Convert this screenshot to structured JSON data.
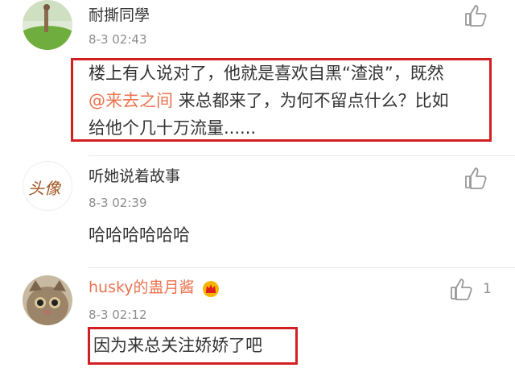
{
  "comments": [
    {
      "username": "耐撕同學",
      "time": "8-3 02:43",
      "text_part1": "楼上有人说对了，他就是喜欢自黑“渣浪”，既然",
      "mention": "@来去之间",
      "text_part2": " 来总都来了，为何不留点什么？比如",
      "text_part3": "给他个几十万流量......"
    },
    {
      "username": "听她说着故事",
      "avatar_text": "头像",
      "time": "8-3 02:39",
      "text": "哈哈哈哈哈哈"
    },
    {
      "username": "husky的蛊月酱",
      "time": "8-3 02:12",
      "text": "因为来总关注娇娇了吧",
      "like_count": "1"
    }
  ],
  "colors": {
    "highlight_box": "#d21f22",
    "mention": "#eb7350",
    "vip_name": "#eb7350"
  }
}
